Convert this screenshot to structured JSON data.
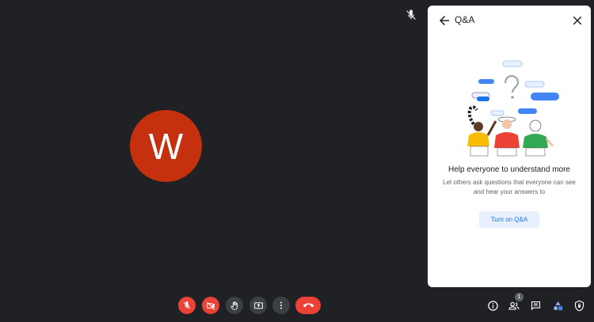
{
  "participant": {
    "initial": "W"
  },
  "panel": {
    "title": "Q&A",
    "help_title": "Help everyone to understand more",
    "help_description": "Let others ask questions that everyone can see and hear your answers to",
    "turn_on_label": "Turn on Q&A"
  },
  "controls": {
    "mic": {
      "icon": "mic-off-icon",
      "state": "off"
    },
    "camera": {
      "icon": "camera-off-icon",
      "state": "off"
    },
    "raise_hand": {
      "icon": "hand-icon"
    },
    "present": {
      "icon": "present-screen-icon"
    },
    "more": {
      "icon": "more-vert-icon"
    },
    "end_call": {
      "icon": "call-end-icon"
    }
  },
  "right_controls": {
    "people_count": "1",
    "icons": [
      "info-icon",
      "people-icon",
      "chat-icon",
      "activities-icon",
      "host-controls-icon"
    ]
  },
  "colors": {
    "background": "#202124",
    "avatar": "#c5300f",
    "danger": "#ea4335",
    "accent": "#1a73e8"
  }
}
